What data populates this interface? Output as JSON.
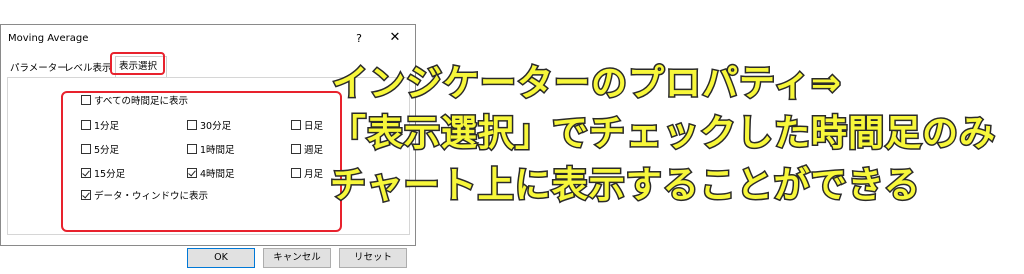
{
  "dialog": {
    "title": "Moving Average",
    "help_label": "?",
    "close_label": "✕",
    "tabs": [
      {
        "label": "パラメーター",
        "selected": false
      },
      {
        "label": "レベル表示",
        "selected": false
      },
      {
        "label": "表示選択",
        "selected": true
      }
    ],
    "checkboxes": {
      "all_timeframes": {
        "label": "すべての時間足に表示",
        "checked": false
      },
      "m1": {
        "label": "1分足",
        "checked": false
      },
      "m30": {
        "label": "30分足",
        "checked": false
      },
      "d1": {
        "label": "日足",
        "checked": false
      },
      "m5": {
        "label": "5分足",
        "checked": false
      },
      "h1": {
        "label": "1時間足",
        "checked": false
      },
      "w1": {
        "label": "週足",
        "checked": false
      },
      "m15": {
        "label": "15分足",
        "checked": true
      },
      "h4": {
        "label": "4時間足",
        "checked": true
      },
      "mn": {
        "label": "月足",
        "checked": false
      },
      "data_window": {
        "label": "データ・ウィンドウに表示",
        "checked": true
      }
    },
    "buttons": {
      "ok": "OK",
      "cancel": "キャンセル",
      "reset": "リセット"
    }
  },
  "annotation": {
    "line1": "インジケーターのプロパティ⇒",
    "line2": "「表示選択」でチェックした時間足のみ",
    "line3": "チャート上に表示することができる"
  },
  "colors": {
    "highlight": "#e8222d",
    "annotation_fill": "#f7f73a",
    "annotation_stroke": "#2a2a2a",
    "ok_border": "#0078d7"
  }
}
